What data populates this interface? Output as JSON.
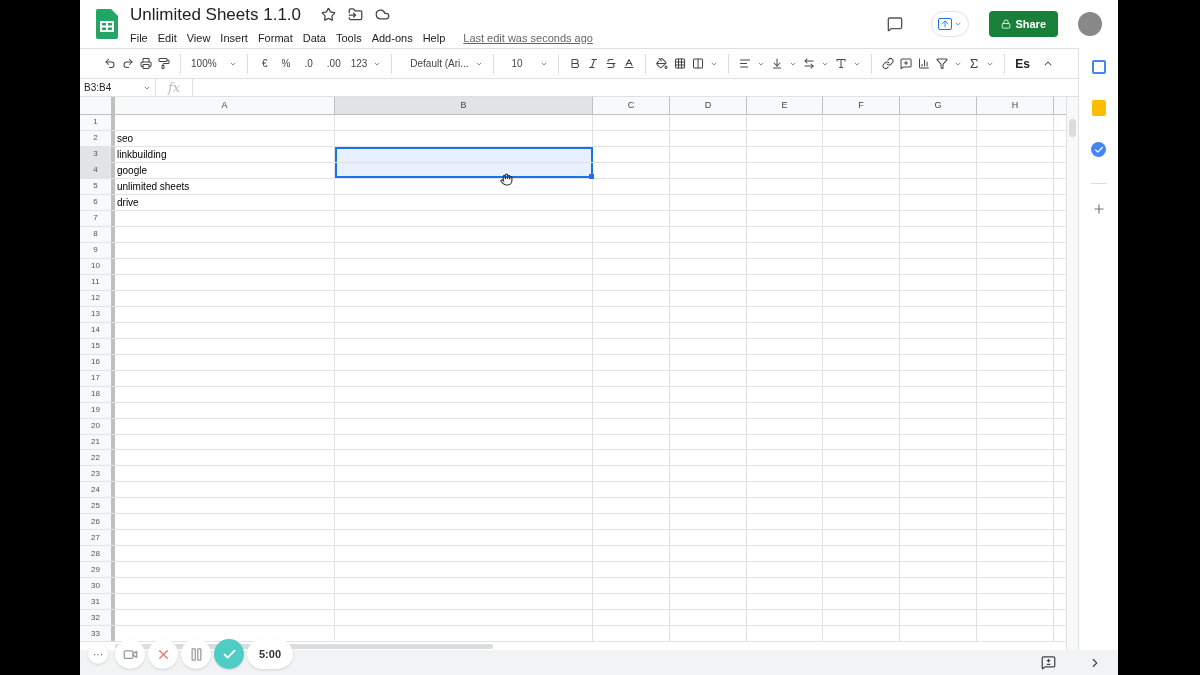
{
  "document": {
    "title": "Unlimited Sheets 1.1.0",
    "last_edit": "Last edit was seconds ago"
  },
  "menu": [
    "File",
    "Edit",
    "View",
    "Insert",
    "Format",
    "Data",
    "Tools",
    "Add-ons",
    "Help"
  ],
  "share_button": {
    "label": "Share"
  },
  "toolbar": {
    "zoom": "100%",
    "currency": "€",
    "percent": "%",
    "decrease_decimals": ".0",
    "increase_decimals": ".00",
    "number_format": "123",
    "font": "Default (Ari...",
    "font_size": "10",
    "extension": "Es"
  },
  "name_box": "B3:B4",
  "formula_label": "fx",
  "columns": [
    {
      "label": "A",
      "selected": false
    },
    {
      "label": "B",
      "selected": true
    },
    {
      "label": "C",
      "selected": false
    },
    {
      "label": "D",
      "selected": false
    },
    {
      "label": "E",
      "selected": false
    },
    {
      "label": "F",
      "selected": false
    },
    {
      "label": "G",
      "selected": false
    },
    {
      "label": "H",
      "selected": false
    }
  ],
  "rows": [
    {
      "label": "1",
      "selected": false
    },
    {
      "label": "2",
      "a": "seo",
      "selected": false
    },
    {
      "label": "3",
      "a": "linkbuilding",
      "selected": true
    },
    {
      "label": "4",
      "a": "google",
      "selected": true
    },
    {
      "label": "5",
      "a": "unlimited sheets",
      "selected": false
    },
    {
      "label": "6",
      "a": "drive",
      "selected": false
    },
    {
      "label": "7",
      "selected": false
    },
    {
      "label": "8",
      "selected": false
    },
    {
      "label": "9",
      "selected": false
    },
    {
      "label": "10",
      "selected": false
    },
    {
      "label": "11",
      "selected": false
    },
    {
      "label": "12",
      "selected": false
    },
    {
      "label": "13",
      "selected": false
    },
    {
      "label": "14",
      "selected": false
    },
    {
      "label": "15",
      "selected": false
    },
    {
      "label": "16",
      "selected": false
    },
    {
      "label": "17",
      "selected": false
    },
    {
      "label": "18",
      "selected": false
    },
    {
      "label": "19",
      "selected": false
    },
    {
      "label": "20",
      "selected": false
    },
    {
      "label": "21",
      "selected": false
    },
    {
      "label": "22",
      "selected": false
    },
    {
      "label": "23",
      "selected": false
    },
    {
      "label": "24",
      "selected": false
    },
    {
      "label": "25",
      "selected": false
    },
    {
      "label": "26",
      "selected": false
    },
    {
      "label": "27",
      "selected": false
    },
    {
      "label": "28",
      "selected": false
    },
    {
      "label": "29",
      "selected": false
    },
    {
      "label": "30",
      "selected": false
    },
    {
      "label": "31",
      "selected": false
    },
    {
      "label": "32",
      "selected": false
    },
    {
      "label": "33",
      "selected": false
    }
  ],
  "recorder": {
    "more": "···",
    "timer": "5:00"
  }
}
